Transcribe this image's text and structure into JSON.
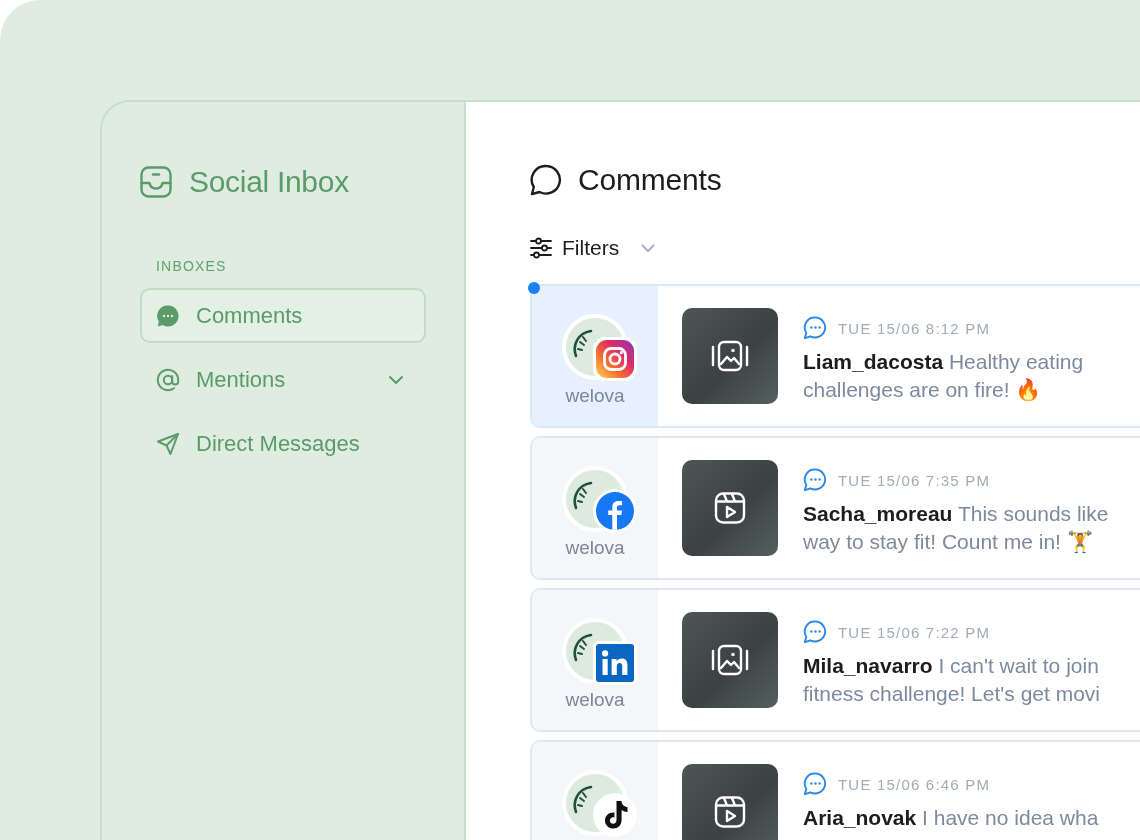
{
  "sidebar": {
    "title": "Social Inbox",
    "section_label": "INBOXES",
    "items": [
      {
        "label": "Comments",
        "selected": true,
        "expandable": false
      },
      {
        "label": "Mentions",
        "selected": false,
        "expandable": true
      },
      {
        "label": "Direct Messages",
        "selected": false,
        "expandable": false
      }
    ]
  },
  "main": {
    "title": "Comments",
    "filter_button": {
      "label": "Filters"
    },
    "comments": [
      {
        "selected": true,
        "unread": true,
        "badge": {
          "kind": "instagram"
        },
        "account": "welova",
        "thumbnail": {
          "kind": "image"
        },
        "time": "TUE 15/06 8:12 PM",
        "text": "**Liam_dacosta** Healthy eating\nchallenges are on fire! 🔥"
      },
      {
        "selected": false,
        "unread": false,
        "badge": {
          "kind": "facebook"
        },
        "account": "welova",
        "thumbnail": {
          "kind": "video"
        },
        "time": "TUE 15/06 7:35 PM",
        "text": "**Sacha_moreau** This sounds like\nway to stay fit! Count me in! 🏋️"
      },
      {
        "selected": false,
        "unread": false,
        "badge": {
          "kind": "linkedin"
        },
        "account": "welova",
        "thumbnail": {
          "kind": "image"
        },
        "time": "TUE 15/06 7:22 PM",
        "text": "**Mila_navarro** I can't wait to join\nfitness challenge! Let's get movi"
      },
      {
        "selected": false,
        "unread": false,
        "badge": {
          "kind": "tiktok"
        },
        "thumbnail": {
          "kind": "video"
        },
        "time": "TUE 15/06 6:46 PM",
        "text": "**Aria_novak** I have no idea wha"
      }
    ]
  }
}
